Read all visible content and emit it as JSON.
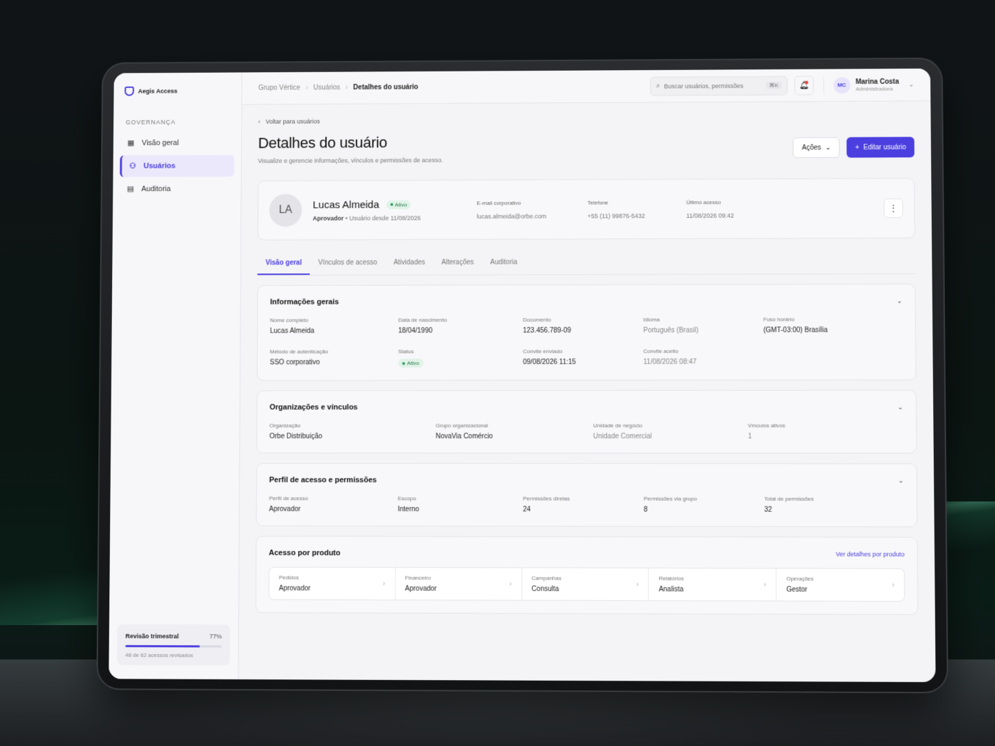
{
  "app": {
    "name": "Aegis Access"
  },
  "sidebar": {
    "section": "GOVERNANÇA",
    "items": [
      {
        "label": "Visão geral",
        "icon": "grid-icon"
      },
      {
        "label": "Usuários",
        "icon": "users-icon",
        "active": true
      },
      {
        "label": "Auditoria",
        "icon": "document-icon"
      }
    ],
    "review": {
      "title": "Revisão trimestral",
      "percent": "77%",
      "progress": 0.77,
      "subtitle": "48 de 62 acessos revisados"
    }
  },
  "breadcrumb": [
    "Grupo Vértice",
    "Usuários",
    "Detalhes do usuário"
  ],
  "search": {
    "placeholder": "Buscar usuários, permissões",
    "shortcut": "⌘K"
  },
  "current_user": {
    "initials": "MC",
    "name": "Marina Costa",
    "role": "Administradora"
  },
  "page": {
    "back": "Voltar para usuários",
    "title": "Detalhes do usuário",
    "description": "Visualize e gerencie informações, vínculos e permissões de acesso.",
    "actions_label": "Ações",
    "edit_label": "Editar usuário"
  },
  "profile": {
    "initials": "LA",
    "name": "Lucas Almeida",
    "status": "Ativo",
    "role": "Aprovador",
    "since": "Usuário desde 11/08/2026",
    "email_label": "E-mail corporativo",
    "email": "lucas.almeida@orbe.com",
    "phone_label": "Telefone",
    "phone": "+55 (11) 99876-5432",
    "last_access_label": "Último acesso",
    "last_access": "11/08/2026 09:42"
  },
  "tabs": [
    "Visão geral",
    "Vínculos de acesso",
    "Atividades",
    "Alterações",
    "Auditoria"
  ],
  "general": {
    "title": "Informações gerais",
    "fields": [
      {
        "label": "Nome completo",
        "value": "Lucas Almeida"
      },
      {
        "label": "Data de nascimento",
        "value": "18/04/1990"
      },
      {
        "label": "Documento",
        "value": "123.456.789-09"
      },
      {
        "label": "Idioma",
        "value": "Português (Brasil)"
      },
      {
        "label": "Fuso horário",
        "value": "(GMT-03:00) Brasília"
      },
      {
        "label": "Método de autenticação",
        "value": "SSO corporativo"
      },
      {
        "label": "Status",
        "value": "Ativo"
      },
      {
        "label": "Convite enviado",
        "value": "09/08/2026 11:15"
      },
      {
        "label": "Convite aceito",
        "value": "11/08/2026 08:47"
      }
    ]
  },
  "orgs": {
    "title": "Organizações e vínculos",
    "fields": [
      {
        "label": "Organização",
        "value": "Orbe Distribuição"
      },
      {
        "label": "Grupo organizacional",
        "value": "NovaVia Comércio"
      },
      {
        "label": "Unidade de negócio",
        "value": "Unidade Comercial"
      },
      {
        "label": "Vínculos ativos",
        "value": "1"
      }
    ]
  },
  "access": {
    "title": "Perfil de acesso e permissões",
    "fields": [
      {
        "label": "Perfil de acesso",
        "value": "Aprovador"
      },
      {
        "label": "Escopo",
        "value": "Interno"
      },
      {
        "label": "Permissões diretas",
        "value": "24"
      },
      {
        "label": "Permissões via grupo",
        "value": "8"
      },
      {
        "label": "Total de permissões",
        "value": "32"
      }
    ]
  },
  "products": {
    "title": "Acesso por produto",
    "link": "Ver detalhes por produto",
    "items": [
      {
        "label": "Pedidos",
        "value": "Aprovador"
      },
      {
        "label": "Financeiro",
        "value": "Aprovador"
      },
      {
        "label": "Campanhas",
        "value": "Consulta"
      },
      {
        "label": "Relatórios",
        "value": "Analista"
      },
      {
        "label": "Operações",
        "value": "Gestor"
      }
    ]
  },
  "colors": {
    "accent": "#4b3fe0",
    "success": "#2a9a5d",
    "alert": "#e54848"
  }
}
